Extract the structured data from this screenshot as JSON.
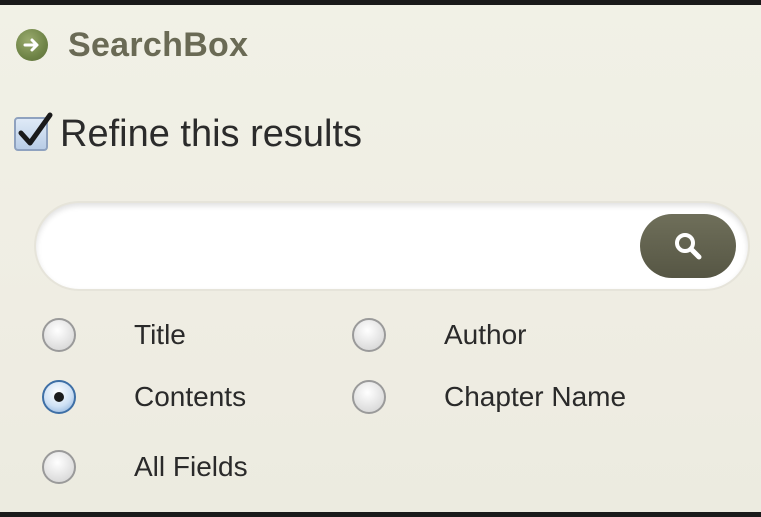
{
  "header": {
    "title": "SearchBox",
    "icon": "arrow-right-circle-icon",
    "icon_color": "#6f8447"
  },
  "refine": {
    "label": "Refine this results",
    "checked": true
  },
  "search": {
    "value": "",
    "placeholder": "",
    "button_icon": "search-icon"
  },
  "options": [
    {
      "label": "Title",
      "checked": false
    },
    {
      "label": "Author",
      "checked": false
    },
    {
      "label": "Contents",
      "checked": true
    },
    {
      "label": "Chapter Name",
      "checked": false
    },
    {
      "label": "All Fields",
      "checked": false
    }
  ]
}
